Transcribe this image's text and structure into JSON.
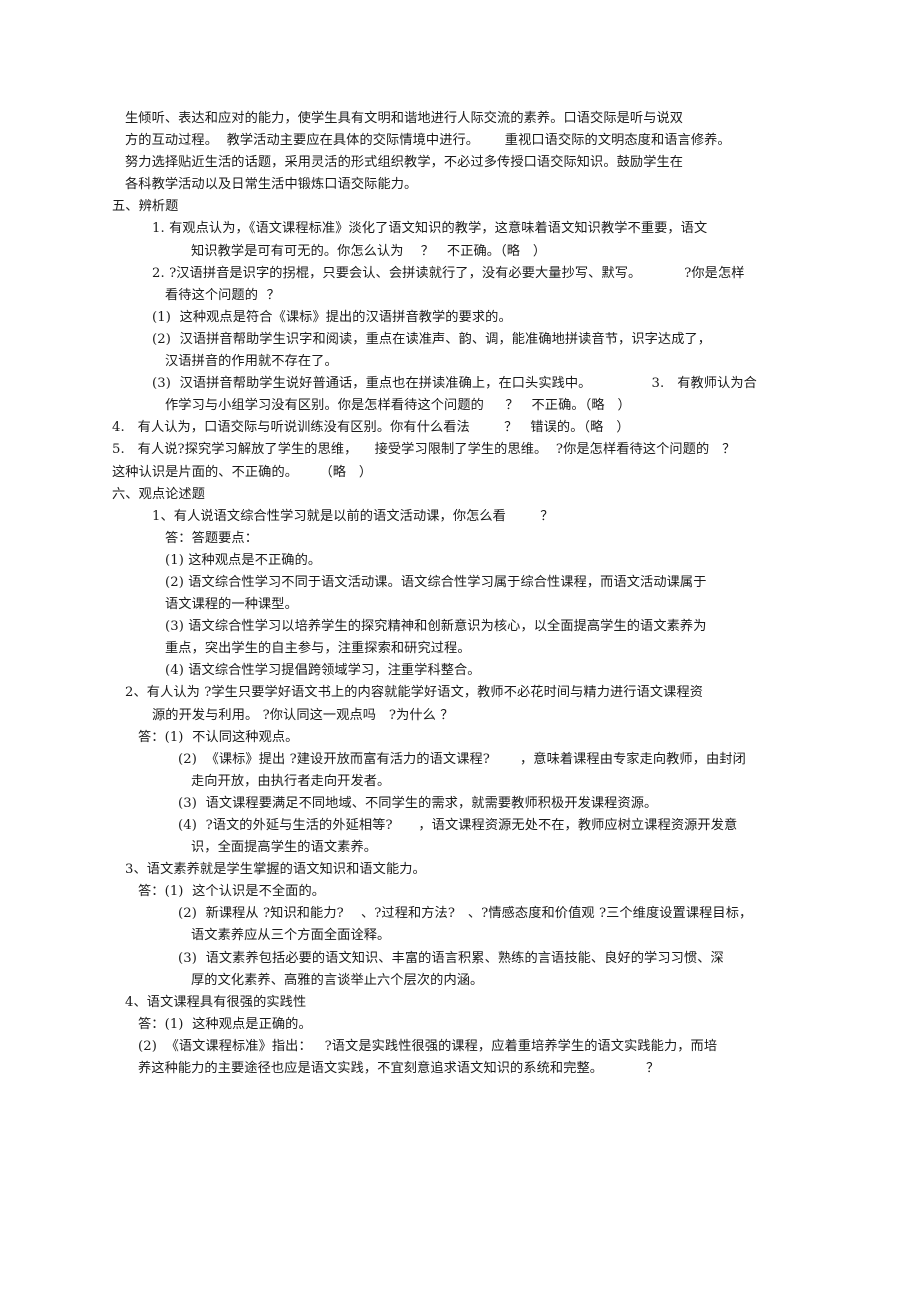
{
  "document": {
    "page_background": "#ffffff",
    "text_color": "#1a1a1a",
    "lines": [
      {
        "id": "l01",
        "indent": 1,
        "text": "生倾听、表达和应对的能力，使学生具有文明和谐地进行人际交流的素养。口语交际是听与说双"
      },
      {
        "id": "l02",
        "indent": 1,
        "text": "方的互动过程。  教学活动主要应在具体的交际情境中进行。      重视口语交际的文明态度和语言修养。"
      },
      {
        "id": "l03",
        "indent": 1,
        "text": "努力选择贴近生活的话题，采用灵活的形式组织教学，不必过多传授口语交际知识。鼓励学生在"
      },
      {
        "id": "l04",
        "indent": 1,
        "text": "各科教学活动以及日常生活中锻炼口语交际能力。"
      },
      {
        "id": "l05",
        "indent": 0,
        "text": "五、辨析题"
      },
      {
        "id": "l06",
        "indent": 3,
        "text": "1. 有观点认为，《语文课程标准》淡化了语文知识的教学，这意味着语文知识教学不重要，语文"
      },
      {
        "id": "l07",
        "indent": 6,
        "text": "知识教学是可有可无的。你怎么认为    ？   不正确。（略   ）"
      },
      {
        "id": "l08",
        "indent": 3,
        "text": "2. ?汉语拼音是识字的拐棍，只要会认、会拼读就行了，没有必要大量抄写、默写。          ?你是怎样"
      },
      {
        "id": "l09",
        "indent": 4,
        "text": "看待这个问题的  ？"
      },
      {
        "id": "l10",
        "indent": 3,
        "text": "(1)  这种观点是符合《课标》提出的汉语拼音教学的要求的。"
      },
      {
        "id": "l11",
        "indent": 3,
        "text": "(2)  汉语拼音帮助学生识字和阅读，重点在读准声、韵、调，能准确地拼读音节，识字达成了，"
      },
      {
        "id": "l12",
        "indent": 4,
        "text": "汉语拼音的作用就不存在了。"
      },
      {
        "id": "l13",
        "indent": 3,
        "text": "(3)  汉语拼音帮助学生说好普通话，重点也在拼读准确上，在口头实践中。              3.   有教师认为合"
      },
      {
        "id": "l14",
        "indent": 4,
        "text": "作学习与小组学习没有区别。你是怎样看待这个问题的     ？   不正确。（略   ）"
      },
      {
        "id": "l15",
        "indent": 0,
        "text": "4.   有人认为，口语交际与听说训练没有区别。你有什么看法        ？   错误的。（略   ）"
      },
      {
        "id": "l16",
        "indent": 0,
        "text": "5.   有人说?探究学习解放了学生的思维，    接受学习限制了学生的思维。  ?你是怎样看待这个问题的   ？"
      },
      {
        "id": "l17",
        "indent": 0,
        "text": "这种认识是片面的、不正确的。     （略   ）"
      },
      {
        "id": "l18",
        "indent": 0,
        "text": "六、观点论述题"
      },
      {
        "id": "l19",
        "indent": 3,
        "text": "1、有人说语文综合性学习就是以前的语文活动课，你怎么看        ？"
      },
      {
        "id": "l20",
        "indent": 4,
        "text": "答：答题要点："
      },
      {
        "id": "l21",
        "indent": 4,
        "text": "(1) 这种观点是不正确的。"
      },
      {
        "id": "l22",
        "indent": 4,
        "text": "(2) 语文综合性学习不同于语文活动课。语文综合性学习属于综合性课程，而语文活动课属于"
      },
      {
        "id": "l23",
        "indent": 4,
        "text": "语文课程的一种课型。"
      },
      {
        "id": "l24",
        "indent": 4,
        "text": "(3) 语文综合性学习以培养学生的探究精神和创新意识为核心，以全面提高学生的语文素养为"
      },
      {
        "id": "l25",
        "indent": 4,
        "text": "重点，突出学生的自主参与，注重探索和研究过程。"
      },
      {
        "id": "l26",
        "indent": 4,
        "text": "(4) 语文综合性学习提倡跨领域学习，注重学科整合。"
      },
      {
        "id": "l27",
        "indent": 1,
        "text": "2、有人认为 ?学生只要学好语文书上的内容就能学好语文，教师不必花时间与精力进行语文课程资"
      },
      {
        "id": "l28",
        "indent": 3,
        "text": "源的开发与利用。 ?你认同这一观点吗   ?为什么 ？"
      },
      {
        "id": "l29",
        "indent": 2,
        "text": "答：(1)  不认同这种观点。"
      },
      {
        "id": "l30",
        "indent": 5,
        "text": "(2)  《课标》提出 ?建设开放而富有活力的语文课程?       ，意味着课程由专家走向教师，由封闭"
      },
      {
        "id": "l31",
        "indent": 6,
        "text": "走向开放，由执行者走向开发者。"
      },
      {
        "id": "l32",
        "indent": 5,
        "text": "(3)  语文课程要满足不同地域、不同学生的需求，就需要教师积极开发课程资源。"
      },
      {
        "id": "l33",
        "indent": 5,
        "text": "(4)  ?语文的外延与生活的外延相等?      ，语文课程资源无处不在，教师应树立课程资源开发意"
      },
      {
        "id": "l34",
        "indent": 6,
        "text": "识，全面提高学生的语文素养。"
      },
      {
        "id": "l35",
        "indent": 1,
        "text": "3、语文素养就是学生掌握的语文知识和语文能力。"
      },
      {
        "id": "l36",
        "indent": 2,
        "text": "答：(1)  这个认识是不全面的。"
      },
      {
        "id": "l37",
        "indent": 5,
        "text": "(2)  新课程从 ?知识和能力?    、?过程和方法?   、?情感态度和价值观 ?三个维度设置课程目标，"
      },
      {
        "id": "l38",
        "indent": 6,
        "text": "语文素养应从三个方面全面诠释。"
      },
      {
        "id": "l39",
        "indent": 5,
        "text": "(3)  语文素养包括必要的语文知识、丰富的语言积累、熟练的言语技能、良好的学习习惯、深"
      },
      {
        "id": "l40",
        "indent": 6,
        "text": "厚的文化素养、高雅的言谈举止六个层次的内涵。"
      },
      {
        "id": "l41",
        "indent": 1,
        "text": "4、语文课程具有很强的实践性"
      },
      {
        "id": "l42",
        "indent": 2,
        "text": "答：(1)  这种观点是正确的。"
      },
      {
        "id": "l43",
        "indent": 2,
        "text": "(2)  《语文课程标准》指出：   ?语文是实践性很强的课程，应着重培养学生的语文实践能力，而培"
      },
      {
        "id": "l44",
        "indent": 2,
        "text": "养这种能力的主要途径也应是语文实践，不宜刻意追求语文知识的系统和完整。          ？"
      }
    ]
  }
}
